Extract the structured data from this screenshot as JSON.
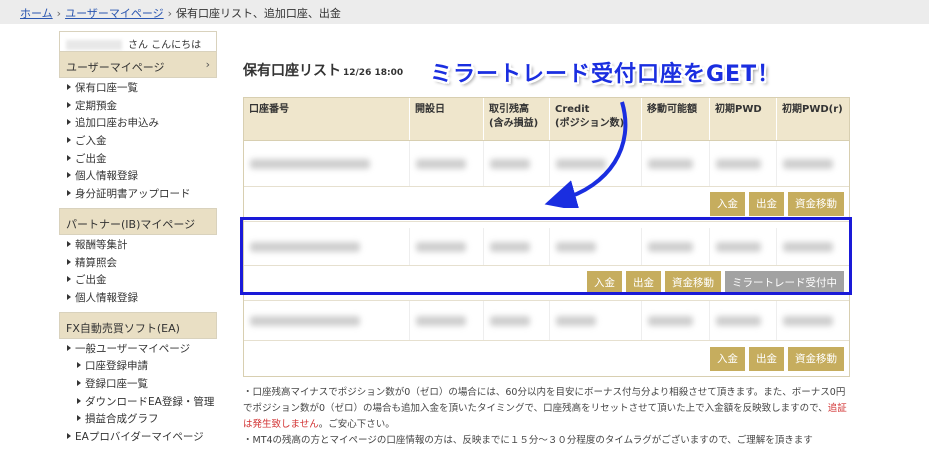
{
  "breadcrumb": {
    "home": "ホーム",
    "mypage": "ユーザーマイページ",
    "current": "保有口座リスト、追加口座、出金",
    "separator": "›"
  },
  "sidebar": {
    "greeting": "さん こんにちは",
    "sections": [
      {
        "label": "ユーザーマイページ",
        "arrow": "›",
        "items": [
          "保有口座一覧",
          "定期預金",
          "追加口座お申込み",
          "ご入金",
          "ご出金",
          "個人情報登録",
          "身分証明書アップロード"
        ]
      },
      {
        "label": "パートナー(IB)マイページ",
        "arrow": "",
        "items": [
          "報酬等集計",
          "精算照会",
          "ご出金",
          "個人情報登録"
        ]
      },
      {
        "label": "FX自動売買ソフト(EA)",
        "arrow": "",
        "items": [
          "一般ユーザーマイページ"
        ],
        "subitems": [
          "口座登録申請",
          "登録口座一覧",
          "ダウンロードEA登録・管理",
          "損益合成グラフ"
        ],
        "after": [
          "EAプロバイダーマイページ"
        ]
      }
    ]
  },
  "main": {
    "title": "保有口座リスト",
    "date": "12/26 18:00",
    "headline": "ミラートレード受付口座をGET！",
    "table": {
      "headers": [
        "口座番号",
        "開設日",
        "取引残高\n(含み損益)",
        "Credit\n(ポジション数)",
        "移動可能額",
        "初期PWD",
        "初期PWD(r)"
      ],
      "buttons": {
        "deposit": "入金",
        "withdraw": "出金",
        "transfer": "資金移動",
        "mirror": "ミラートレード受付中"
      }
    },
    "notes": {
      "line1": "・口座残高マイナスでポジション数が0（ゼロ）の場合には、60分以内を目安にボーナス付与分より相殺させて頂きます。また、ボーナス0円でポジション数が0（ゼロ）の場合も追加入金を頂いたタイミングで、口座残高をリセットさせて頂いた上で入金額を反映致しますので、",
      "line1_red": "追証は発生致しません",
      "line1_end": "。ご安心下さい。",
      "line2": "・MT4の残高の方とマイページの口座情報の方は、反映までに１５分～３０分程度のタイムラグがございますので、ご理解を頂きます"
    }
  },
  "colors": {
    "accent_gold": "#c6ad5e",
    "highlight_blue": "#1a1ad8",
    "headline_blue": "#1a2ee0",
    "header_bg": "#efe6cc",
    "mirror_gray": "#a2a2a2"
  }
}
